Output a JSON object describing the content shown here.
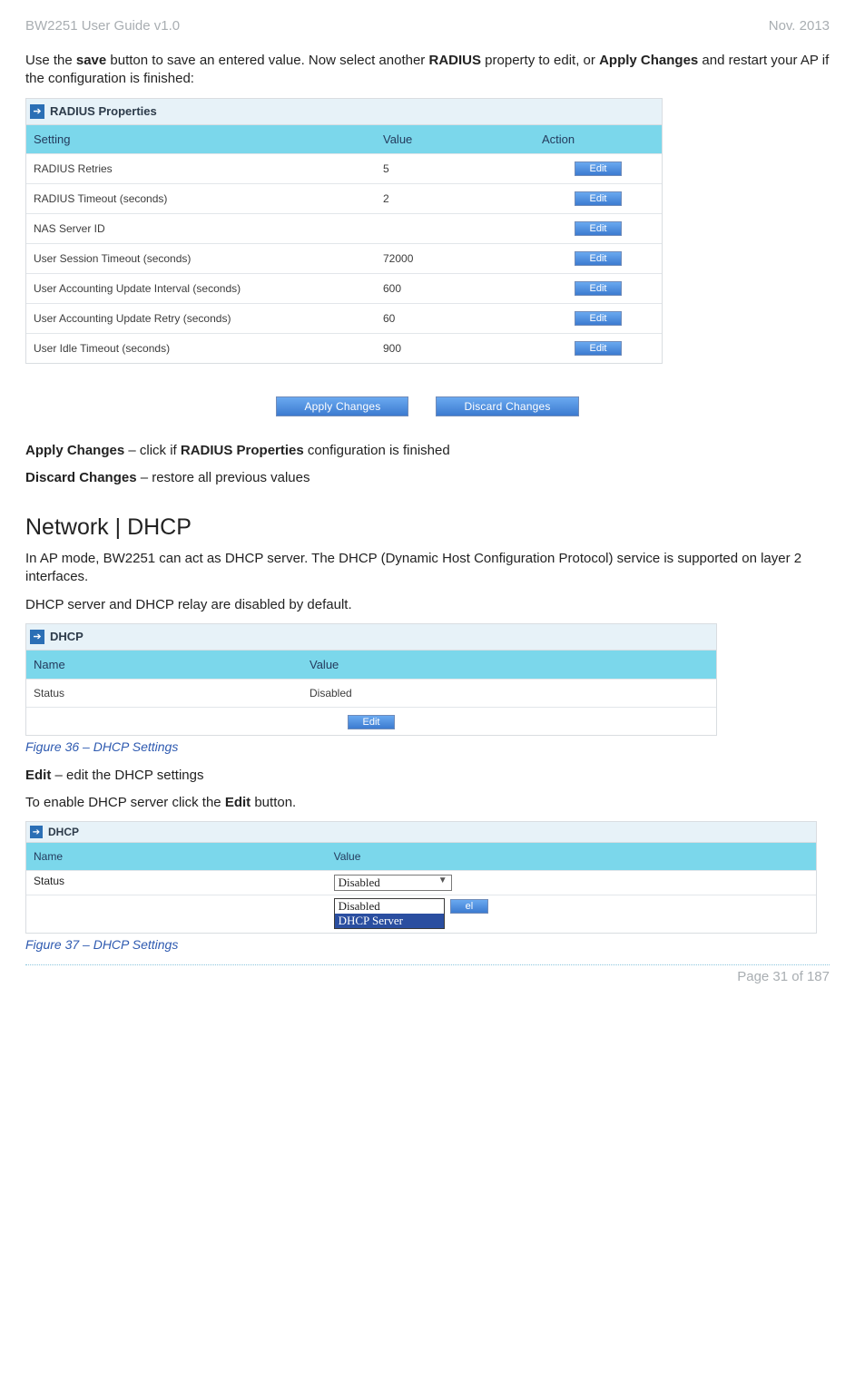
{
  "header": {
    "left": "BW2251 User Guide v1.0",
    "right": "Nov.  2013"
  },
  "intro": {
    "p1_a": "Use the ",
    "p1_save": "save",
    "p1_b": " button to save an entered value. Now select another ",
    "p1_radius": "RADIUS",
    "p1_c": " property to edit, or ",
    "p1_apply": "Apply Changes",
    "p1_d": " and restart your AP if the configuration is finished:"
  },
  "radius": {
    "panel_title": "RADIUS Properties",
    "columns": {
      "c1": "Setting",
      "c2": "Value",
      "c3": "Action"
    },
    "edit_label": "Edit",
    "rows": [
      {
        "setting": "RADIUS Retries",
        "value": "5"
      },
      {
        "setting": "RADIUS Timeout (seconds)",
        "value": "2"
      },
      {
        "setting": "NAS Server ID",
        "value": ""
      },
      {
        "setting": "User Session Timeout (seconds)",
        "value": "72000"
      },
      {
        "setting": "User Accounting Update Interval (seconds)",
        "value": "600"
      },
      {
        "setting": "User Accounting Update Retry (seconds)",
        "value": "60"
      },
      {
        "setting": "User Idle Timeout (seconds)",
        "value": "900"
      }
    ],
    "apply_btn": "Apply Changes",
    "discard_btn": "Discard Changes"
  },
  "post_radius": {
    "apply_label": "Apply Changes",
    "apply_desc": " – click if ",
    "apply_bold2": "RADIUS Properties",
    "apply_desc2": " configuration is finished",
    "discard_label": "Discard Changes",
    "discard_desc": " – restore all previous values"
  },
  "dhcp": {
    "heading": "Network | DHCP",
    "para1": "In AP mode, BW2251 can act as DHCP server. The DHCP (Dynamic Host Configuration Protocol) service is supported on layer 2 interfaces.",
    "para2": "DHCP server and DHCP relay are disabled by default.",
    "panel_title": "DHCP",
    "columns": {
      "c1": "Name",
      "c2": "Value"
    },
    "row": {
      "name": "Status",
      "value": "Disabled"
    },
    "edit_label": "Edit",
    "fig36": "Figure 36 – DHCP Settings",
    "edit_bold": "Edit",
    "edit_desc": " – edit the DHCP settings",
    "enable_a": "To enable DHCP server click the ",
    "enable_b": "Edit",
    "enable_c": " button.",
    "panel2": {
      "title": "DHCP",
      "col1": "Name",
      "col2": "Value",
      "row_name": "Status",
      "select_value": "Disabled",
      "options": [
        "Disabled",
        "DHCP Server"
      ],
      "cancel_suffix": "el"
    },
    "fig37": "Figure 37 – DHCP Settings"
  },
  "footer": {
    "page": "Page 31 of 187"
  }
}
